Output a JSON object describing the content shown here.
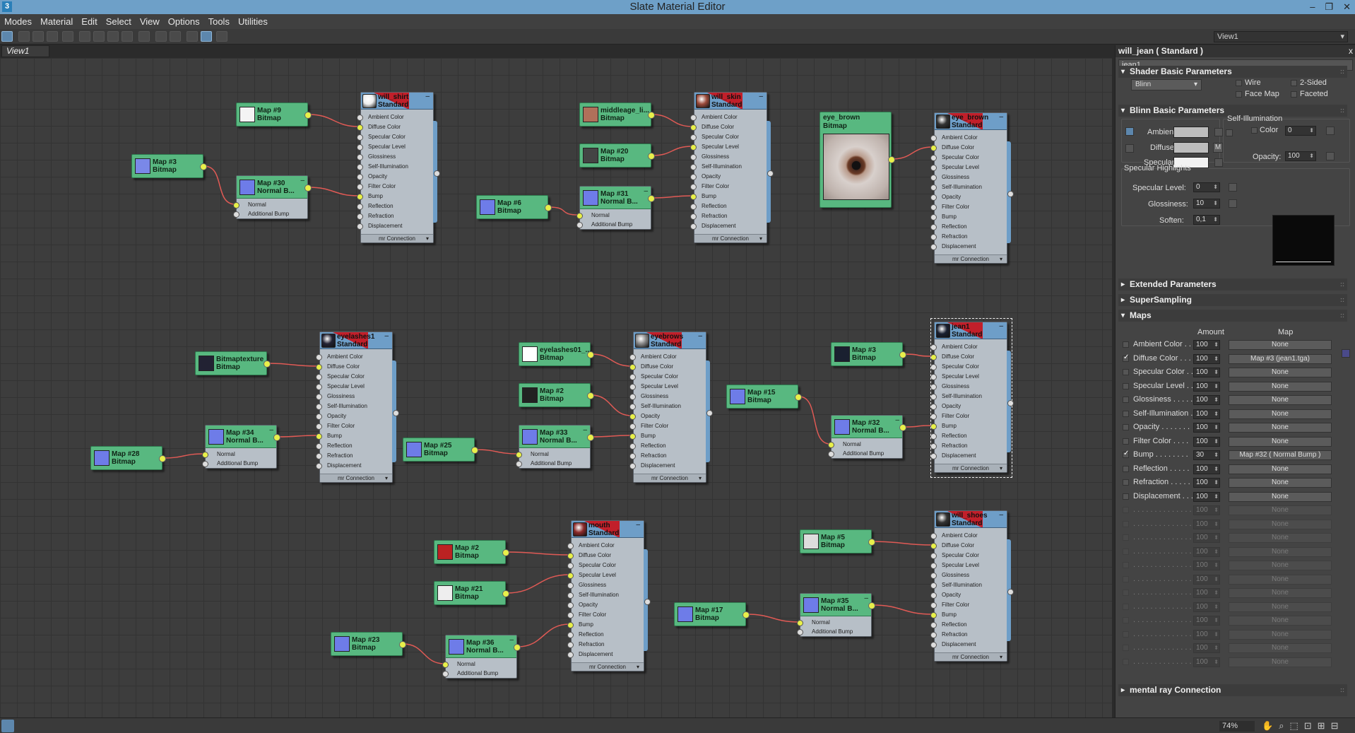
{
  "window": {
    "title": "Slate Material Editor",
    "minimize": "–",
    "restore": "❐",
    "close": "✕"
  },
  "menu": [
    "Modes",
    "Material",
    "Edit",
    "Select",
    "View",
    "Options",
    "Tools",
    "Utilities"
  ],
  "toolbar": {
    "view_select": "View1"
  },
  "view_tab": "View1",
  "status": {
    "zoom": "74%"
  },
  "colors": {
    "map_node": "#58b880",
    "material_header": "#6e9ec8",
    "wire": "#e05a55",
    "socket_active": "#e8f04a",
    "canvas": "#3d3d3d"
  },
  "icons": [
    "select-icon",
    "picker-icon",
    "move-children-icon",
    "delete-icon",
    "layout-icon",
    "hide-icon",
    "show-icon",
    "material-preview-icon",
    "pan-icon",
    "zoom-icon",
    "zoom-extents-icon",
    "hand-icon"
  ],
  "mat_slots": [
    "Ambient Color",
    "Diffuse Color",
    "Specular Color",
    "Specular Level",
    "Glossiness",
    "Self-Illumination",
    "Opacity",
    "Filter Color",
    "Bump",
    "Reflection",
    "Refraction",
    "Displacement"
  ],
  "mat_footer": "mr Connection",
  "normal_slots": [
    "Normal",
    "Additional Bump"
  ],
  "nodes": {
    "m9": {
      "name": "Map #9",
      "type": "Bitmap"
    },
    "m3a": {
      "name": "Map #3",
      "type": "Bitmap"
    },
    "m30": {
      "name": "Map #30",
      "type": "Normal B..."
    },
    "shirt": {
      "name": "will_shirt",
      "type": "Standard"
    },
    "ml": {
      "name": "middleage_li...",
      "type": "Bitmap"
    },
    "m20": {
      "name": "Map #20",
      "type": "Bitmap"
    },
    "m6": {
      "name": "Map #6",
      "type": "Bitmap"
    },
    "m31": {
      "name": "Map #31",
      "type": "Normal B..."
    },
    "skin": {
      "name": "will_skin",
      "type": "Standard"
    },
    "eyeb": {
      "name": "eye_brown",
      "type": "Bitmap"
    },
    "eyebm": {
      "name": "eye_brown",
      "type": "Standard"
    },
    "bmt": {
      "name": "Bitmaptexture",
      "type": "Bitmap"
    },
    "m34": {
      "name": "Map #34",
      "type": "Normal B..."
    },
    "m28": {
      "name": "Map #28",
      "type": "Bitmap"
    },
    "eyelash": {
      "name": "eyelashes1",
      "type": "Standard"
    },
    "el01": {
      "name": "eyelashes01_...",
      "type": "Bitmap"
    },
    "m2a": {
      "name": "Map #2",
      "type": "Bitmap"
    },
    "m25": {
      "name": "Map #25",
      "type": "Bitmap"
    },
    "m33": {
      "name": "Map #33",
      "type": "Normal B..."
    },
    "brows": {
      "name": "eyebrows",
      "type": "Standard"
    },
    "m15": {
      "name": "Map #15",
      "type": "Bitmap"
    },
    "m3b": {
      "name": "Map #3",
      "type": "Bitmap"
    },
    "m32": {
      "name": "Map #32",
      "type": "Normal B..."
    },
    "jean": {
      "name": "jean1",
      "type": "Standard"
    },
    "m2b": {
      "name": "Map #2",
      "type": "Bitmap"
    },
    "m21": {
      "name": "Map #21",
      "type": "Bitmap"
    },
    "m23": {
      "name": "Map #23",
      "type": "Bitmap"
    },
    "m36": {
      "name": "Map #36",
      "type": "Normal B..."
    },
    "mouth": {
      "name": "mouth",
      "type": "Standard"
    },
    "m5": {
      "name": "Map #5",
      "type": "Bitmap"
    },
    "m17": {
      "name": "Map #17",
      "type": "Bitmap"
    },
    "m35": {
      "name": "Map #35",
      "type": "Normal B..."
    },
    "shoes": {
      "name": "will_shoes",
      "type": "Standard"
    }
  },
  "panel": {
    "title": "will_jean  ( Standard )",
    "close": "x",
    "name_field": "jean1",
    "rollouts": {
      "shader": "Shader Basic Parameters",
      "blinn": "Blinn Basic Parameters",
      "extended": "Extended Parameters",
      "supersampling": "SuperSampling",
      "maps": "Maps",
      "mr": "mental ray Connection"
    },
    "shader": {
      "type": "Blinn",
      "wire": "Wire",
      "two_sided": "2-Sided",
      "face_map": "Face Map",
      "faceted": "Faceted"
    },
    "blinn": {
      "self_illum_title": "Self-Illumination",
      "color_label": "Color",
      "color_value": "0",
      "ambient": "Ambient:",
      "diffuse": "Diffuse:",
      "specular": "Specular:",
      "m_button": "M",
      "opacity_label": "Opacity:",
      "opacity_value": "100",
      "spec_title": "Specular Highlights",
      "spec_level_label": "Specular Level:",
      "spec_level": "0",
      "gloss_label": "Glossiness:",
      "gloss": "10",
      "soften_label": "Soften:",
      "soften": "0,1"
    },
    "maps_header": {
      "amount": "Amount",
      "map": "Map"
    },
    "maps": [
      {
        "name": "Ambient Color . . . .",
        "amount": "100",
        "map": "None",
        "checked": false
      },
      {
        "name": "Diffuse Color . . . .",
        "amount": "100",
        "map": "Map #3 (jean1.tga)",
        "checked": true
      },
      {
        "name": "Specular Color . .",
        "amount": "100",
        "map": "None",
        "checked": false
      },
      {
        "name": "Specular Level . .",
        "amount": "100",
        "map": "None",
        "checked": false
      },
      {
        "name": "Glossiness . . . . . .",
        "amount": "100",
        "map": "None",
        "checked": false
      },
      {
        "name": "Self-Illumination . .",
        "amount": "100",
        "map": "None",
        "checked": false
      },
      {
        "name": "Opacity . . . . . . .",
        "amount": "100",
        "map": "None",
        "checked": false
      },
      {
        "name": "Filter Color . . . .",
        "amount": "100",
        "map": "None",
        "checked": false
      },
      {
        "name": "Bump . . . . . . . .",
        "amount": "30",
        "map": "Map #32  ( Normal Bump )",
        "checked": true
      },
      {
        "name": "Reflection . . . . .",
        "amount": "100",
        "map": "None",
        "checked": false
      },
      {
        "name": "Refraction . . . . .",
        "amount": "100",
        "map": "None",
        "checked": false
      },
      {
        "name": "Displacement . . . .",
        "amount": "100",
        "map": "None",
        "checked": false
      }
    ],
    "empty_map_row": {
      "name": ". . . . . . . . . . . . . .",
      "amount": "100",
      "map": "None"
    }
  }
}
